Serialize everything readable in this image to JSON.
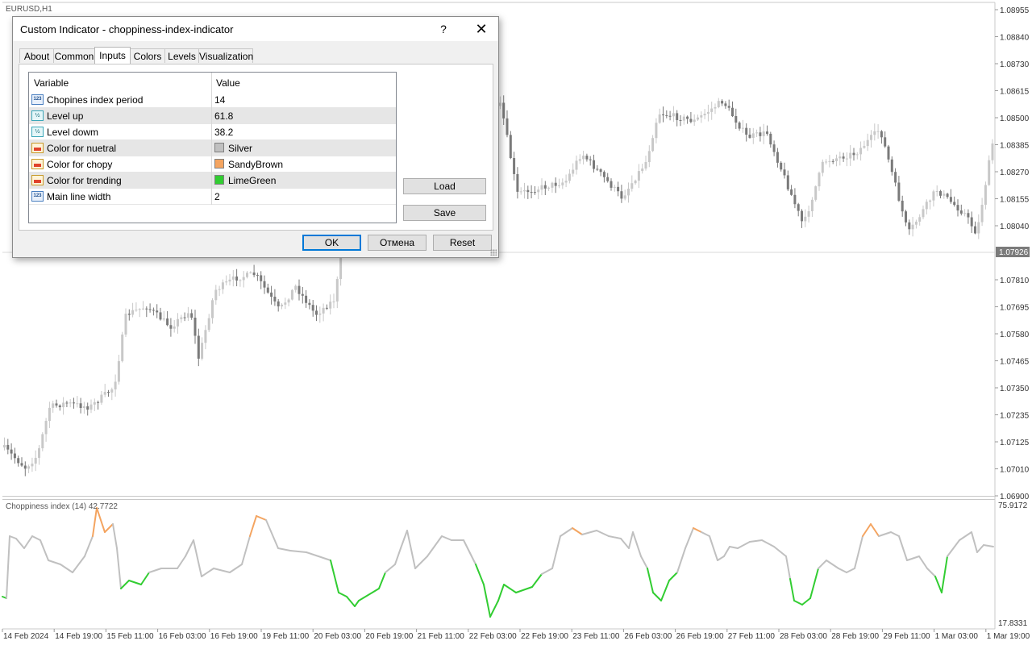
{
  "chart": {
    "symbol_label": "EURUSD,H1",
    "price_labels": [
      "1.08955",
      "1.08840",
      "1.08730",
      "1.08615",
      "1.08500",
      "1.08385",
      "1.08270",
      "1.08155",
      "1.08040",
      "1.07926",
      "1.07810",
      "1.07695",
      "1.07580",
      "1.07465",
      "1.07350",
      "1.07235",
      "1.07125",
      "1.07010",
      "1.06900"
    ],
    "current_price": "1.07926",
    "indicator_label": "Choppiness index (14) 42.7722",
    "indicator_scale": [
      "75.9172",
      "17.8331"
    ],
    "time_labels": [
      "14 Feb 2024",
      "14 Feb 19:00",
      "15 Feb 11:00",
      "16 Feb 03:00",
      "16 Feb 19:00",
      "19 Feb 11:00",
      "20 Feb 03:00",
      "20 Feb 19:00",
      "21 Feb 11:00",
      "22 Feb 03:00",
      "22 Feb 19:00",
      "23 Feb 11:00",
      "26 Feb 03:00",
      "26 Feb 19:00",
      "27 Feb 11:00",
      "28 Feb 03:00",
      "28 Feb 19:00",
      "29 Feb 11:00",
      "1 Mar 03:00",
      "1 Mar 19:00"
    ],
    "colors": {
      "bull": "#c8c8c8",
      "bear": "#7a7a7a",
      "neutral": "#C0C0C0",
      "choppy": "#F4A460",
      "trending": "#32CD32"
    }
  },
  "dialog": {
    "title": "Custom Indicator - choppiness-index-indicator",
    "help": "?",
    "close": "✕",
    "tabs": [
      "About",
      "Common",
      "Inputs",
      "Colors",
      "Levels",
      "Visualization"
    ],
    "active_tab": "Inputs",
    "grid": {
      "col_variable": "Variable",
      "col_value": "Value",
      "rows": [
        {
          "icon": "123",
          "name": "Chopines index period",
          "value": "14"
        },
        {
          "icon": "½",
          "name": "Level up",
          "value": "61.8"
        },
        {
          "icon": "½",
          "name": "Level dowm",
          "value": "38.2"
        },
        {
          "icon": "",
          "name": "Color for nuetral",
          "value": "Silver",
          "swatch": "#C0C0C0"
        },
        {
          "icon": "",
          "name": "Color for chopy",
          "value": "SandyBrown",
          "swatch": "#F4A460"
        },
        {
          "icon": "",
          "name": "Color for trending",
          "value": "LimeGreen",
          "swatch": "#32CD32"
        },
        {
          "icon": "123",
          "name": "Main line width",
          "value": "2"
        }
      ]
    },
    "buttons": {
      "load": "Load",
      "save": "Save",
      "ok": "OK",
      "cancel": "Отмена",
      "reset": "Reset"
    }
  }
}
